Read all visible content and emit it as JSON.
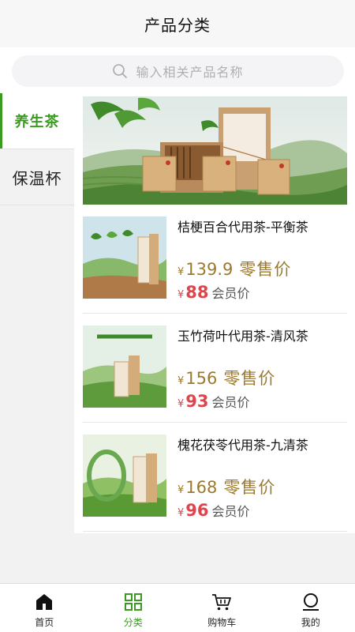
{
  "header": {
    "title": "产品分类"
  },
  "search": {
    "placeholder": "输入相关产品名称",
    "icon": "search-icon"
  },
  "sidebar": {
    "items": [
      {
        "label": "养生茶",
        "active": true
      },
      {
        "label": "保温杯",
        "active": false
      }
    ]
  },
  "products": [
    {
      "name": "桔梗百合代用茶-平衡茶",
      "currency": "¥",
      "retail_price": "139.9",
      "retail_label": "零售价",
      "member_price": "88",
      "member_label": "会员价"
    },
    {
      "name": "玉竹荷叶代用茶-清风茶",
      "currency": "¥",
      "retail_price": "156",
      "retail_label": "零售价",
      "member_price": "93",
      "member_label": "会员价"
    },
    {
      "name": "槐花茯苓代用茶-九清茶",
      "currency": "¥",
      "retail_price": "168",
      "retail_label": "零售价",
      "member_price": "96",
      "member_label": "会员价"
    }
  ],
  "tabs": [
    {
      "label": "首页",
      "icon": "home-icon",
      "active": false
    },
    {
      "label": "分类",
      "icon": "category-grid-icon",
      "active": true
    },
    {
      "label": "购物车",
      "icon": "cart-icon",
      "active": false
    },
    {
      "label": "我的",
      "icon": "profile-icon",
      "active": false
    }
  ],
  "colors": {
    "accent": "#3a9a22",
    "retail_price": "#9b7a2f",
    "member_price": "#e0444a"
  }
}
